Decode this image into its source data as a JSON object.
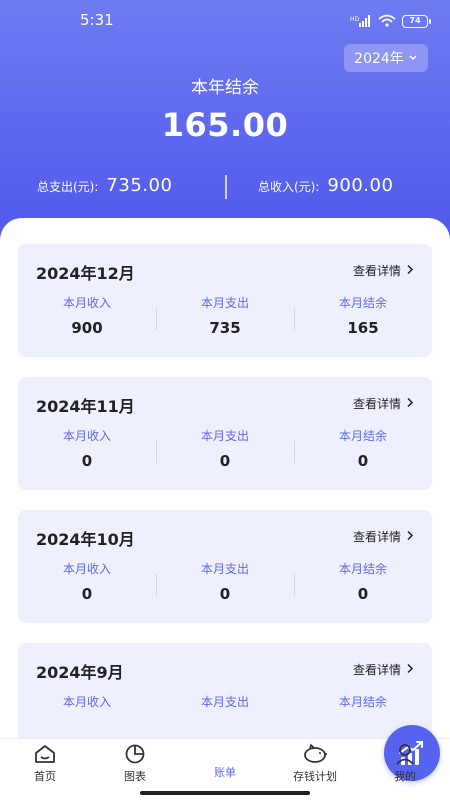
{
  "status": {
    "time": "5:31",
    "network": "HD",
    "battery": "74"
  },
  "year_selector": {
    "label": "2024年"
  },
  "hero": {
    "balance_label": "本年结余",
    "balance_value": "165.00",
    "expense_label": "总支出(元):",
    "expense_value": "735.00",
    "income_label": "总收入(元):",
    "income_value": "900.00"
  },
  "months": [
    {
      "title": "2024年12月",
      "link": "查看详情",
      "income_label": "本月收入",
      "income": "900",
      "expense_label": "本月支出",
      "expense": "735",
      "balance_label": "本月结余",
      "balance": "165"
    },
    {
      "title": "2024年11月",
      "link": "查看详情",
      "income_label": "本月收入",
      "income": "0",
      "expense_label": "本月支出",
      "expense": "0",
      "balance_label": "本月结余",
      "balance": "0"
    },
    {
      "title": "2024年10月",
      "link": "查看详情",
      "income_label": "本月收入",
      "income": "0",
      "expense_label": "本月支出",
      "expense": "0",
      "balance_label": "本月结余",
      "balance": "0"
    },
    {
      "title": "2024年9月",
      "link": "查看详情",
      "income_label": "本月收入",
      "income": "",
      "expense_label": "本月支出",
      "expense": "",
      "balance_label": "本月结余",
      "balance": ""
    }
  ],
  "nav": [
    {
      "label": "首页",
      "icon": "home-icon"
    },
    {
      "label": "图表",
      "icon": "pie-chart-icon"
    },
    {
      "label": "账单",
      "icon": "trend-chart-icon",
      "active": true
    },
    {
      "label": "存钱计划",
      "icon": "piggy-bank-icon"
    },
    {
      "label": "我的",
      "icon": "user-icon"
    }
  ],
  "colors": {
    "accent": "#5f6ae8",
    "hero_top": "#6f7cf2",
    "hero_bottom": "#4f58ea",
    "card_bg": "#eef0fd"
  }
}
